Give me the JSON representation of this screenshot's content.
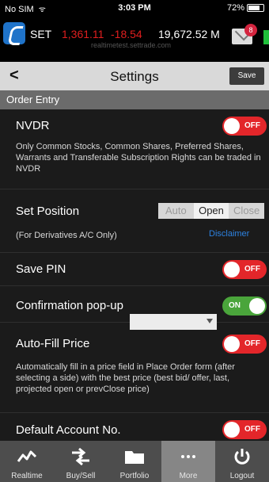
{
  "status_bar": {
    "carrier": "No SIM",
    "wifi": "ᯤ",
    "time": "3:03 PM",
    "battery": "72%"
  },
  "ticker": {
    "index": "SET",
    "price": "1,361.11",
    "change": "-18.54",
    "value": "19,672.52 M",
    "sub_text": "realtimetest.settrade.com",
    "mail_badge": "8",
    "colors": {
      "down": "#e01e1e",
      "brand": "#1f73c9"
    }
  },
  "nav": {
    "back_glyph": "<",
    "title": "Settings",
    "save_label": "Save"
  },
  "section": {
    "title": "Order Entry"
  },
  "settings": {
    "nvdr": {
      "title": "NVDR",
      "toggle": "OFF",
      "desc": "Only Common Stocks, Common Shares, Preferred Shares, Warrants and Transferable Subscription Rights can be traded in NVDR"
    },
    "set_position": {
      "title": "Set Position",
      "options": [
        "Auto",
        "Open",
        "Close"
      ],
      "selected": "Open",
      "note": "(For Derivatives A/C Only)",
      "disclaimer": "Disclaimer"
    },
    "save_pin": {
      "title": "Save PIN",
      "toggle": "OFF"
    },
    "confirmation": {
      "title": "Confirmation pop-up",
      "toggle": "ON"
    },
    "auto_fill": {
      "title": "Auto-Fill Price",
      "toggle": "OFF",
      "desc": "Automatically fill in a price field in Place Order form (after selecting a side) with the best price (best bid/ offer, last, projected open or prevClose price)"
    },
    "default_account": {
      "title": "Default Account No.",
      "value": "",
      "toggle": "OFF"
    }
  },
  "tabs": [
    {
      "label": "Realtime",
      "icon": "realtime-chart-icon"
    },
    {
      "label": "Buy/Sell",
      "icon": "buy-sell-icon"
    },
    {
      "label": "Portfolio",
      "icon": "portfolio-folder-icon"
    },
    {
      "label": "More",
      "icon": "more-dots-icon"
    },
    {
      "label": "Logout",
      "icon": "power-icon"
    }
  ],
  "active_tab": "More"
}
